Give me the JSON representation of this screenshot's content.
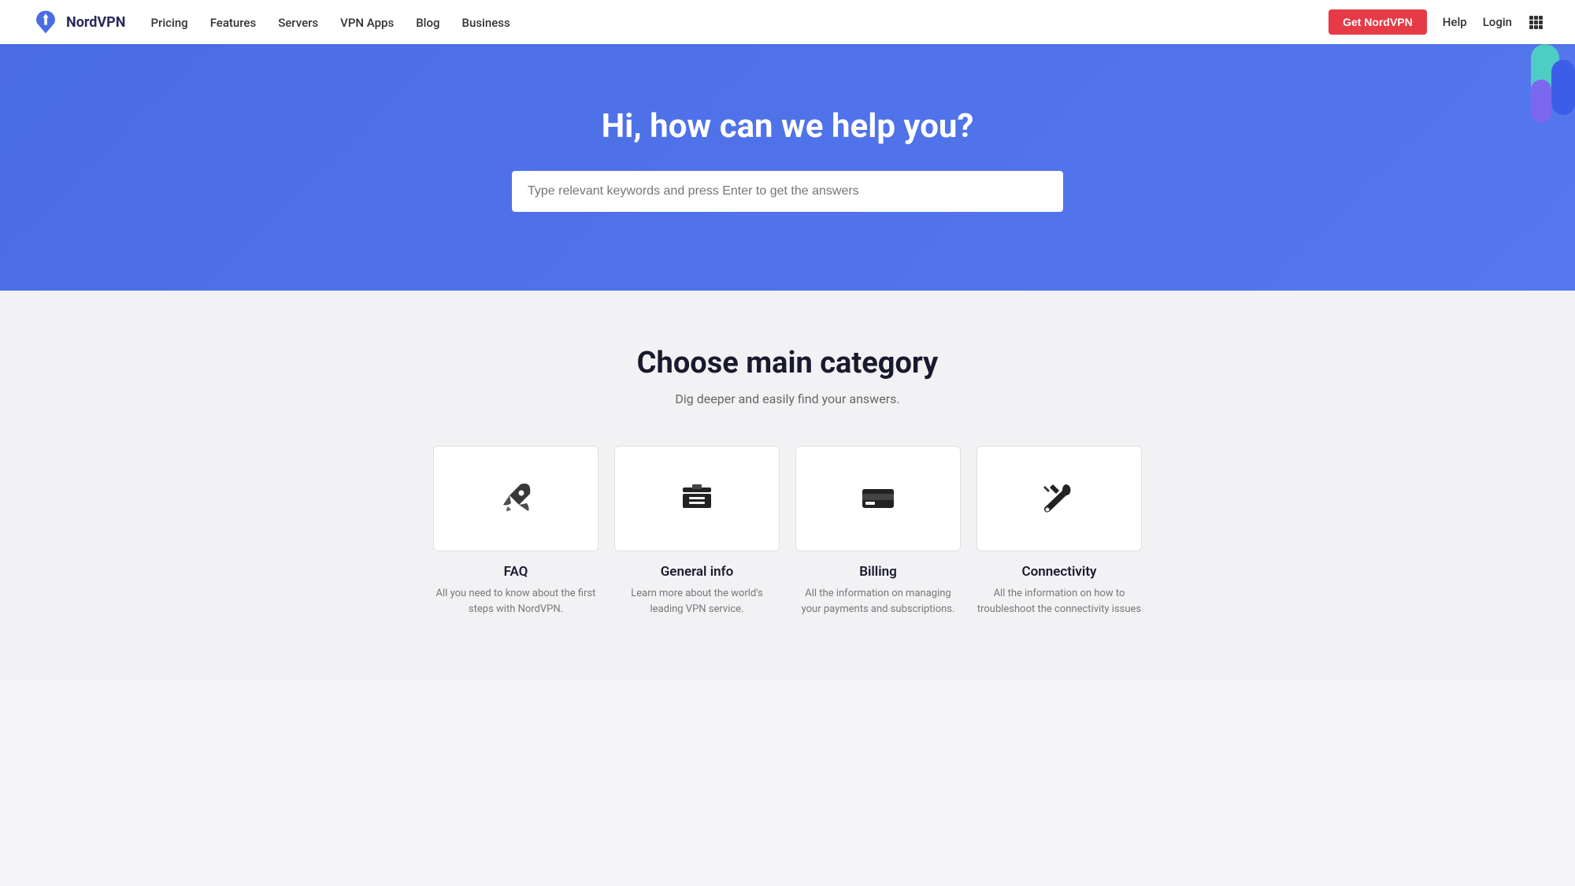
{
  "navbar": {
    "logo_text": "NordVPN",
    "nav_links": [
      {
        "label": "Pricing",
        "id": "pricing"
      },
      {
        "label": "Features",
        "id": "features"
      },
      {
        "label": "Servers",
        "id": "servers"
      },
      {
        "label": "VPN Apps",
        "id": "vpn-apps"
      },
      {
        "label": "Blog",
        "id": "blog"
      },
      {
        "label": "Business",
        "id": "business"
      }
    ],
    "cta_button": "Get NordVPN",
    "help_label": "Help",
    "login_label": "Login"
  },
  "hero": {
    "heading": "Hi, how can we help you?",
    "search_placeholder": "Type relevant keywords and press Enter to get the answers"
  },
  "main": {
    "heading": "Choose main category",
    "subtitle": "Dig deeper and easily find your answers.",
    "categories": [
      {
        "id": "faq",
        "label": "FAQ",
        "description": "All you need to know about the first steps with NordVPN.",
        "icon": "rocket"
      },
      {
        "id": "general-info",
        "label": "General info",
        "description": "Learn more about the world's leading VPN service.",
        "icon": "briefcase"
      },
      {
        "id": "billing",
        "label": "Billing",
        "description": "All the information on managing your payments and subscriptions.",
        "icon": "credit-card"
      },
      {
        "id": "connectivity",
        "label": "Connectivity",
        "description": "All the information on how to troubleshoot the connectivity issues",
        "icon": "tools"
      }
    ]
  },
  "colors": {
    "hero_bg": "#4a6de5",
    "cta_bg": "#e63a46",
    "icon_color": "#2a2a2a"
  }
}
